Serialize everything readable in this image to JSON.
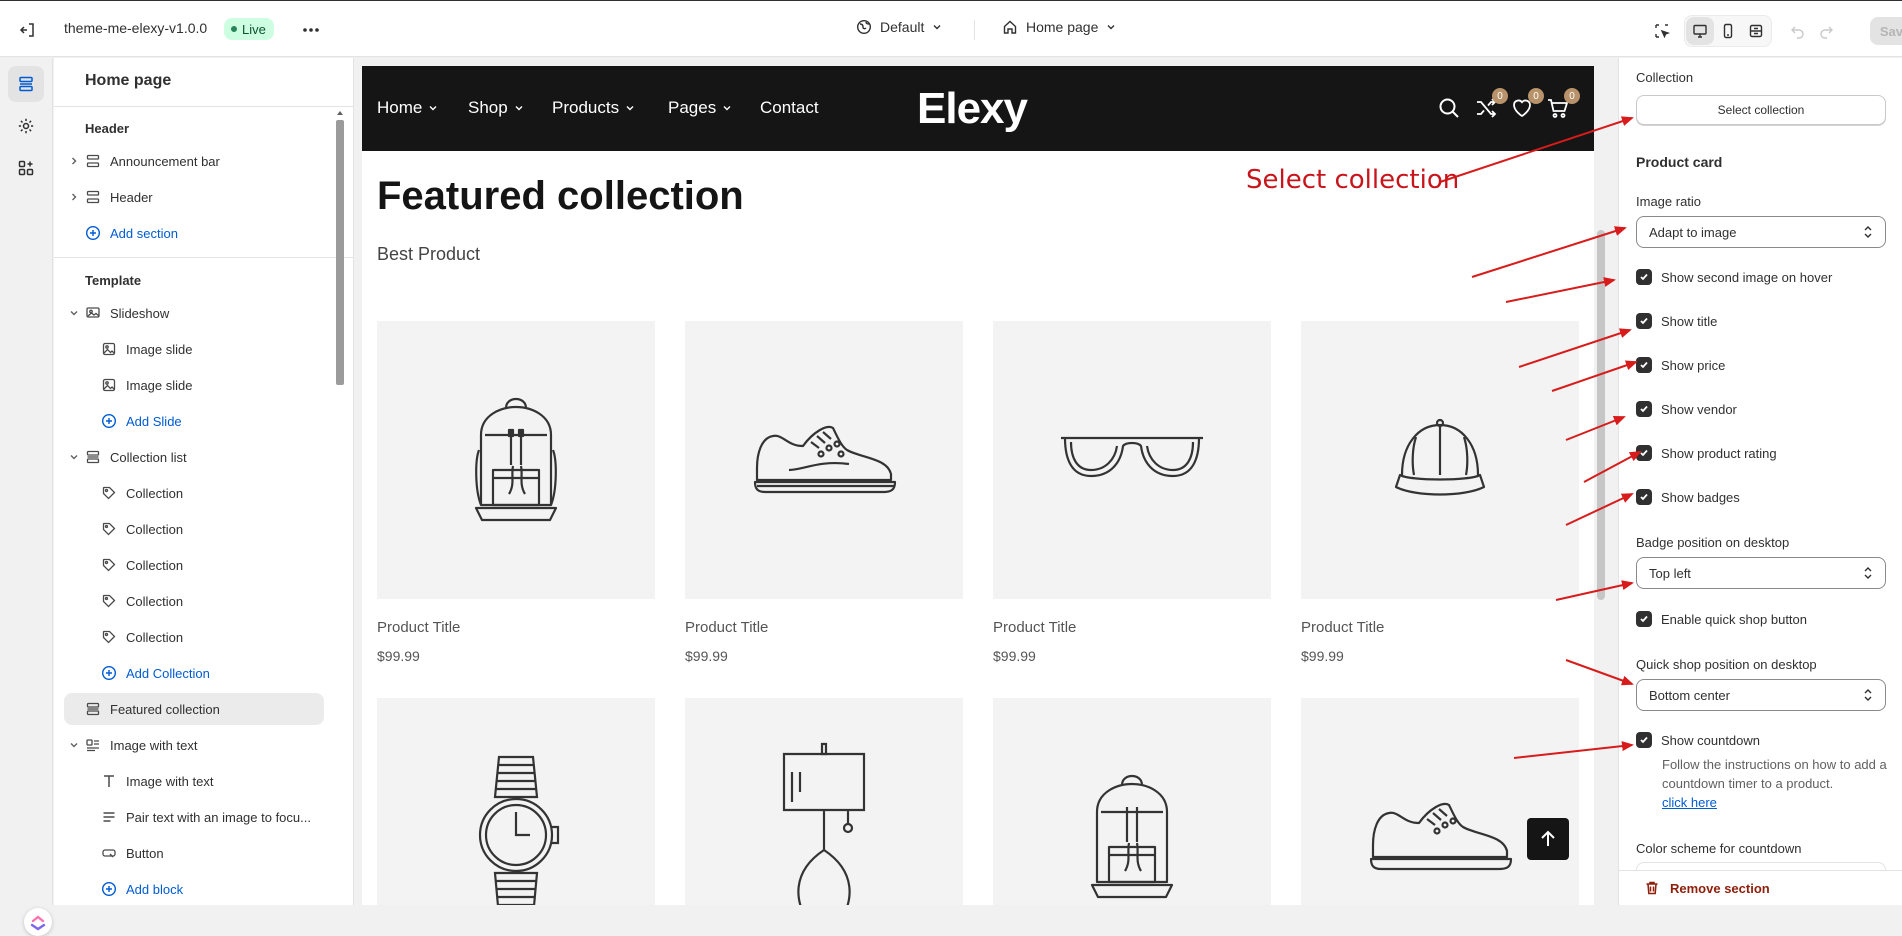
{
  "topbar": {
    "theme_name": "theme-me-elexy-v1.0.0",
    "live_badge": "Live",
    "theme_setting": "Default",
    "page_selector": "Home page",
    "save_label": "Save"
  },
  "sidebar": {
    "title": "Home page",
    "header_group": "Header",
    "header_items": [
      "Announcement bar",
      "Header"
    ],
    "header_add": "Add section",
    "template_group": "Template",
    "slideshow": {
      "label": "Slideshow",
      "children": [
        "Image slide",
        "Image slide"
      ],
      "add": "Add Slide"
    },
    "collection_list": {
      "label": "Collection list",
      "children": [
        "Collection",
        "Collection",
        "Collection",
        "Collection",
        "Collection"
      ],
      "add": "Add Collection"
    },
    "featured_collection": "Featured collection",
    "image_with_text": {
      "label": "Image with text",
      "children": [
        "Image with text",
        "Pair text with an image to focu...",
        "Button"
      ],
      "add": "Add block"
    }
  },
  "preview": {
    "nav": [
      "Home",
      "Shop",
      "Products",
      "Pages",
      "Contact"
    ],
    "logo": "Elexy",
    "counts": {
      "compare": "0",
      "wishlist": "0",
      "cart": "0"
    },
    "heading": "Featured collection",
    "subheading": "Best Product",
    "products": [
      {
        "title": "Product Title",
        "price": "$99.99",
        "icon": "backpack-icon"
      },
      {
        "title": "Product Title",
        "price": "$99.99",
        "icon": "sneaker-icon"
      },
      {
        "title": "Product Title",
        "price": "$99.99",
        "icon": "sunglasses-icon"
      },
      {
        "title": "Product Title",
        "price": "$99.99",
        "icon": "cap-icon"
      }
    ],
    "row2_icons": [
      "watch-icon",
      "lamp-icon",
      "backpack-icon",
      "sneaker-icon"
    ]
  },
  "settings": {
    "collection_label": "Collection",
    "select_collection_btn": "Select collection",
    "product_card_head": "Product card",
    "image_ratio_label": "Image ratio",
    "image_ratio_value": "Adapt to image",
    "checks": {
      "second_image": "Show second image on hover",
      "title": "Show title",
      "price": "Show price",
      "vendor": "Show vendor",
      "rating": "Show product rating",
      "badges": "Show badges"
    },
    "badge_position_label": "Badge position on desktop",
    "badge_position_value": "Top left",
    "quick_shop": "Enable quick shop button",
    "quick_shop_position_label": "Quick shop position on desktop",
    "quick_shop_position_value": "Bottom center",
    "countdown": "Show countdown",
    "countdown_help": "Follow the instructions on how to add a countdown timer to a product.",
    "countdown_link": "click here",
    "color_scheme_label": "Color scheme for countdown",
    "remove_section": "Remove section"
  },
  "annotation": {
    "label": "Select collection",
    "color": "#c8151b"
  },
  "colors": {
    "accent": "#005bd3",
    "live_bg": "#cdfee1",
    "nav_bg": "#151515",
    "badge": "#b8926a",
    "danger": "#8e1f0b"
  }
}
